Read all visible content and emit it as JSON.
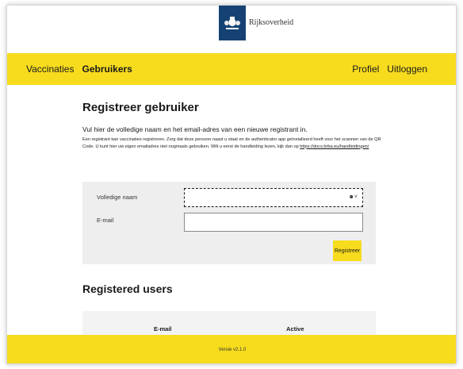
{
  "header": {
    "logo_text": "Rijksoverheid",
    "logo_bar_color": "#154273"
  },
  "nav": {
    "left": [
      {
        "label": "Vaccinaties",
        "active": false
      },
      {
        "label": "Gebruikers",
        "active": true
      }
    ],
    "right": [
      {
        "label": "Profiel"
      },
      {
        "label": "Uitloggen"
      }
    ],
    "color": "#f7dc1e"
  },
  "main": {
    "title": "Registreer gebruiker",
    "lead": "Vul hier de volledige naam en het email-adres van een nieuwe registrant in.",
    "desc_text": "Een registrant kan vaccinaties registreren. Zorg dat deze persoon naast u staat en de authenticator app geïnstalleerd heeft voor het scannen van de QR Code. U kunt hier uw eigen emailadres niet nogmaals gebruiken. Wilt u eerst de handleiding lezen, kijk dan op",
    "desc_link": "https://docs.brba.eu/handleidingen/",
    "form": {
      "name_label": "Volledige naam",
      "name_value": "",
      "email_label": "E-mail",
      "email_value": "",
      "submit_label": "Registreer",
      "name_icon": "person-dropdown-icon"
    }
  },
  "users": {
    "title": "Registered users",
    "columns": [
      "E-mail",
      "Active"
    ]
  },
  "footer": {
    "version": "Versie v2.1.0"
  }
}
